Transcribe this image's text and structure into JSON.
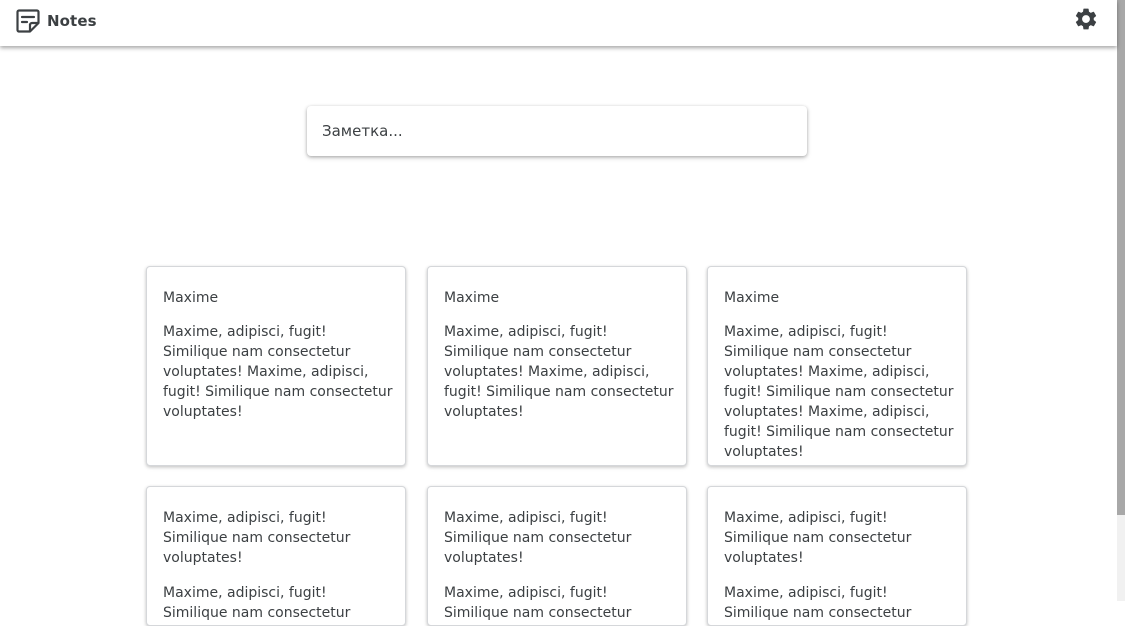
{
  "header": {
    "title": "Notes",
    "logo_icon": "note-icon",
    "settings_icon": "gear-icon"
  },
  "composer": {
    "placeholder": "Заметка..."
  },
  "notes": [
    {
      "title": "Maxime",
      "paragraphs": [
        "Maxime, adipisci, fugit! Similique nam consectetur voluptates! Maxime, adipisci, fugit! Similique nam consectetur voluptates!"
      ]
    },
    {
      "title": "Maxime",
      "paragraphs": [
        "Maxime, adipisci, fugit! Similique nam consectetur voluptates! Maxime, adipisci, fugit! Similique nam consectetur voluptates!"
      ]
    },
    {
      "title": "Maxime",
      "paragraphs": [
        "Maxime, adipisci, fugit! Similique nam consectetur voluptates! Maxime, adipisci, fugit! Similique nam consectetur voluptates! Maxime, adipisci, fugit! Similique nam consectetur voluptates!"
      ]
    },
    {
      "title": "",
      "paragraphs": [
        "Maxime, adipisci, fugit! Similique nam consectetur voluptates!",
        "Maxime, adipisci, fugit! Similique nam consectetur voluptates!"
      ]
    },
    {
      "title": "",
      "paragraphs": [
        "Maxime, adipisci, fugit! Similique nam consectetur voluptates!",
        "Maxime, adipisci, fugit! Similique nam consectetur voluptates!"
      ]
    },
    {
      "title": "",
      "paragraphs": [
        "Maxime, adipisci, fugit! Similique nam consectetur voluptates!",
        "Maxime, adipisci, fugit! Similique nam consectetur voluptates!"
      ]
    }
  ]
}
